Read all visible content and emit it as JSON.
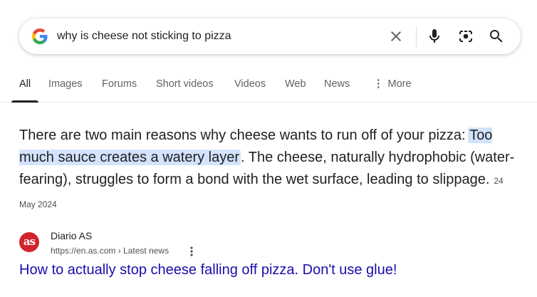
{
  "search": {
    "query": "why is cheese not sticking to pizza",
    "icons": [
      "google-logo-icon",
      "clear-icon",
      "microphone-icon",
      "lens-camera-icon",
      "search-icon"
    ]
  },
  "tabs": [
    {
      "label": "All",
      "active": true
    },
    {
      "label": "Images"
    },
    {
      "label": "Forums"
    },
    {
      "label": "Short videos"
    },
    {
      "label": "Videos"
    },
    {
      "label": "Web"
    },
    {
      "label": "News"
    },
    {
      "label": "More"
    }
  ],
  "snippet": {
    "intro": "There are two main reasons why cheese wants to run off of your pizza:",
    "highlight": "Too much sauce creates a watery layer",
    "rest": ". The cheese, naturally hydrophobic (water-fearing), struggles to form a bond with the wet surface, leading to slippage.",
    "date": "24 May 2024"
  },
  "source": {
    "favicon_text": "as",
    "name": "Diario AS",
    "url": "https://en.as.com › Latest news"
  },
  "result": {
    "title": "How to actually stop cheese falling off pizza. Don't use glue!"
  },
  "colors": {
    "highlight": "#d3e3fd",
    "link": "#1a0dab",
    "favicon_bg": "#d2232a"
  }
}
